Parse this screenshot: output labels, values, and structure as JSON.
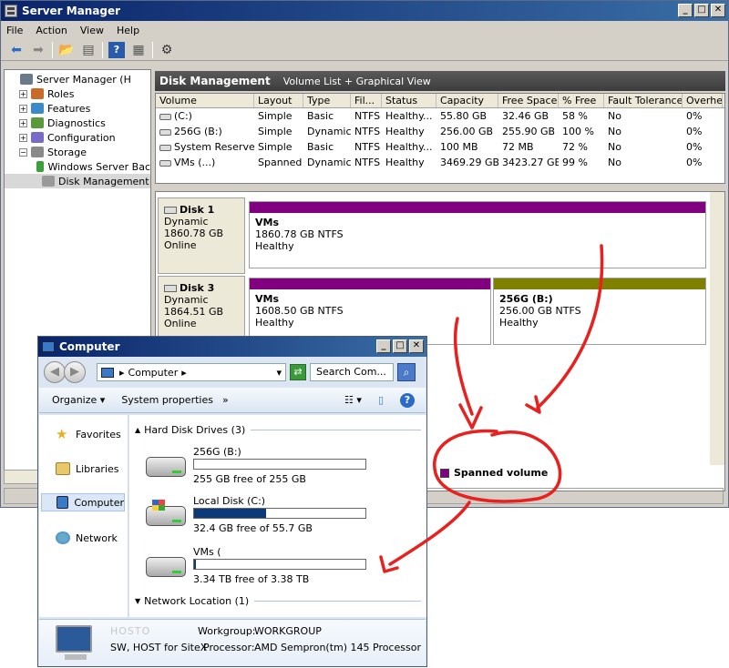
{
  "server_manager": {
    "title": "Server Manager",
    "menu": [
      "File",
      "Action",
      "View",
      "Help"
    ],
    "caption_buttons": [
      "_",
      "□",
      "✕"
    ],
    "tree": [
      {
        "label": "Server Manager (H",
        "indent": 0,
        "expander": "",
        "icon": "server-icon"
      },
      {
        "label": "Roles",
        "indent": 1,
        "expander": "+",
        "icon": "roles-icon"
      },
      {
        "label": "Features",
        "indent": 1,
        "expander": "+",
        "icon": "features-icon"
      },
      {
        "label": "Diagnostics",
        "indent": 1,
        "expander": "+",
        "icon": "diagnostics-icon"
      },
      {
        "label": "Configuration",
        "indent": 1,
        "expander": "+",
        "icon": "configuration-icon"
      },
      {
        "label": "Storage",
        "indent": 1,
        "expander": "−",
        "icon": "storage-icon"
      },
      {
        "label": "Windows Server Bac",
        "indent": 2,
        "expander": "",
        "icon": "backup-icon"
      },
      {
        "label": "Disk Management",
        "indent": 2,
        "expander": "",
        "icon": "disk-management-icon"
      }
    ],
    "dm_header": {
      "title": "Disk Management",
      "subtitle": "Volume List + Graphical View"
    },
    "volume_columns": [
      "Volume",
      "Layout",
      "Type",
      "Fil...",
      "Status",
      "Capacity",
      "Free Space",
      "% Free",
      "Fault Tolerance",
      "Overhe"
    ],
    "volumes": [
      [
        "(C:)",
        "Simple",
        "Basic",
        "NTFS",
        "Healthy...",
        "55.80 GB",
        "32.46 GB",
        "58 %",
        "No",
        "0%"
      ],
      [
        "256G (B:)",
        "Simple",
        "Dynamic",
        "NTFS",
        "Healthy",
        "256.00 GB",
        "255.90 GB",
        "100 %",
        "No",
        "0%"
      ],
      [
        "System Reserved",
        "Simple",
        "Basic",
        "NTFS",
        "Healthy...",
        "100 MB",
        "72 MB",
        "72 %",
        "No",
        "0%"
      ],
      [
        "VMs (...)",
        "Spanned",
        "Dynamic",
        "NTFS",
        "Healthy",
        "3469.29 GB",
        "3423.27 GB",
        "99 %",
        "No",
        "0%"
      ]
    ],
    "disks": [
      {
        "name": "Disk 1",
        "type": "Dynamic",
        "size": "1860.78 GB",
        "state": "Online",
        "partitions": [
          {
            "name": "VMs",
            "size": "1860.78 GB NTFS",
            "status": "Healthy",
            "color": "#800080"
          }
        ]
      },
      {
        "name": "Disk 3",
        "type": "Dynamic",
        "size": "1864.51 GB",
        "state": "Online",
        "partitions": [
          {
            "name": "VMs",
            "size": "1608.50 GB NTFS",
            "status": "Healthy",
            "color": "#800080"
          },
          {
            "name": "256G  (B:)",
            "size": "256.00 GB NTFS",
            "status": "Healthy",
            "color": "#808000"
          }
        ]
      }
    ],
    "legend": {
      "label": "Spanned volume",
      "color": "#800080"
    }
  },
  "computer": {
    "title": "Computer",
    "caption_buttons": [
      "_",
      "□",
      "✕"
    ],
    "address": "Computer",
    "search_placeholder": "Search Com...",
    "commands": [
      "Organize",
      "System properties",
      "»"
    ],
    "nav": [
      "Favorites",
      "Libraries",
      "Computer",
      "Network"
    ],
    "group_hdd": "Hard Disk Drives (3)",
    "group_net": "Network Location (1)",
    "drives": [
      {
        "name": "256G (B:)",
        "free": "255 GB free of 255 GB",
        "used_fraction": 0.0,
        "icon": "hard-drive-icon"
      },
      {
        "name": "Local Disk (C:)",
        "free": "32.4 GB free of 55.7 GB",
        "used_fraction": 0.42,
        "icon": "windows-drive-icon"
      },
      {
        "name": "VMs (",
        "free": "3.34 TB free of 3.38 TB",
        "used_fraction": 0.01,
        "icon": "hard-drive-icon"
      }
    ],
    "details": {
      "host_name": "HOSTO",
      "workgroup_label": "Workgroup:",
      "workgroup_value": "WORKGROUP",
      "description": "SW, HOST for SiteX",
      "processor_label": "Processor:",
      "processor_value": "AMD Sempron(tm) 145 Processor"
    }
  },
  "annotation": {
    "color": "#e8201e"
  }
}
